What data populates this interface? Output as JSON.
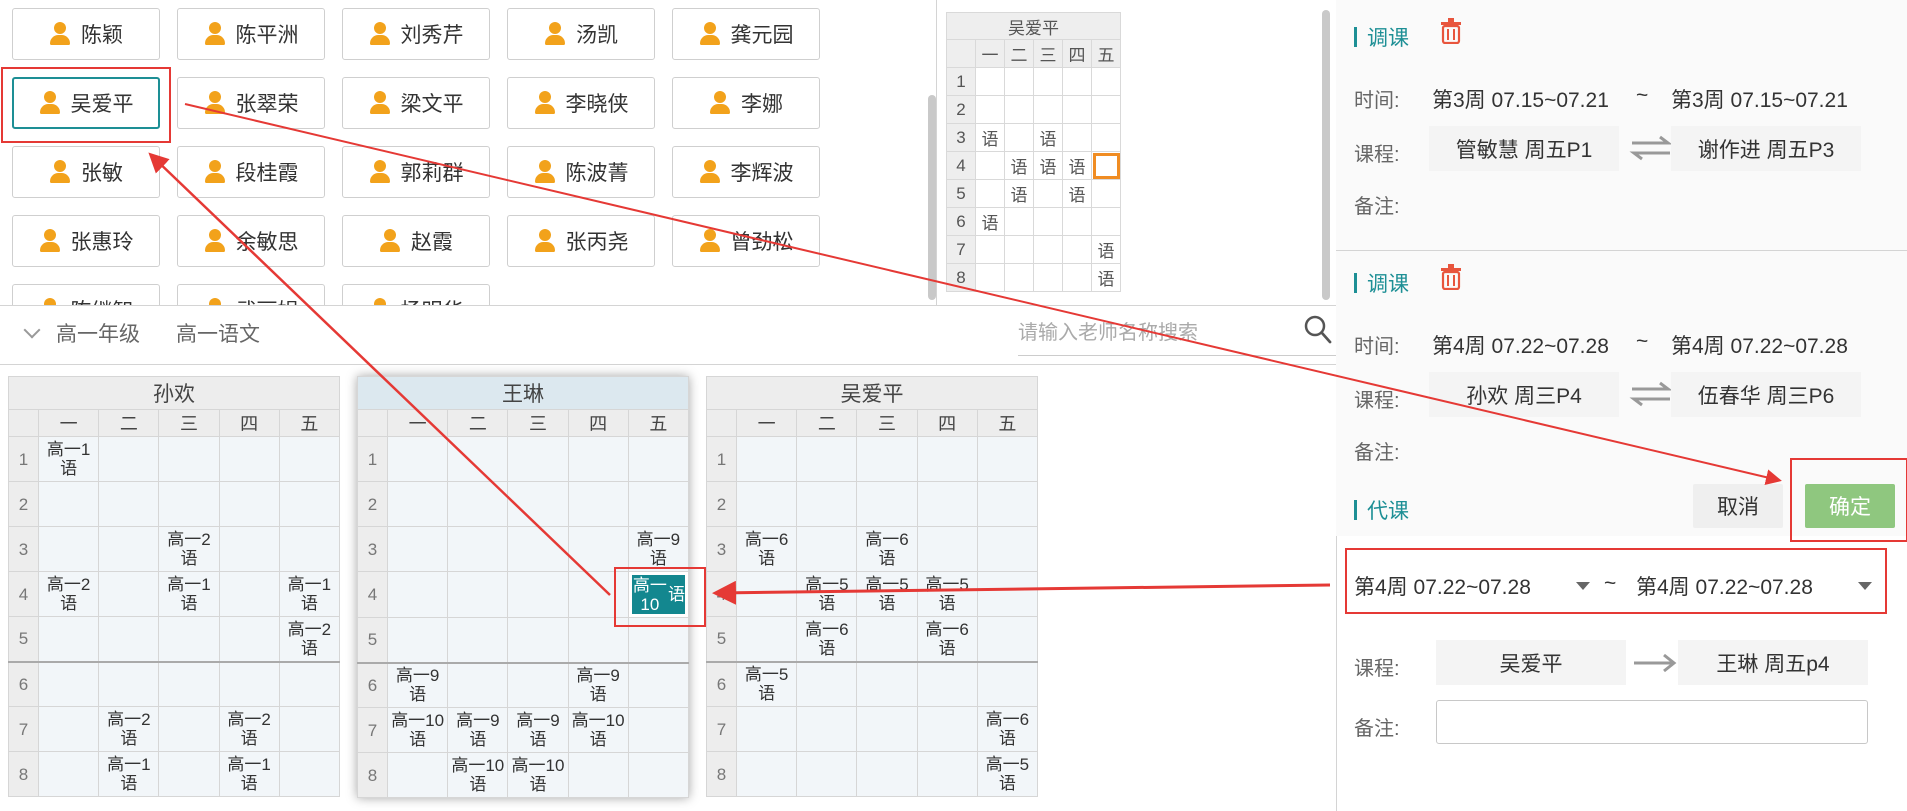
{
  "teacher_chips": [
    "陈颖",
    "陈平洲",
    "刘秀芹",
    "汤凯",
    "龚元园",
    "吴爱平",
    "张翠荣",
    "梁文平",
    "李晓侠",
    "李娜",
    "张敏",
    "段桂霞",
    "郭莉群",
    "陈波菁",
    "李辉波",
    "张惠玲",
    "余敏思",
    "赵霞",
    "张丙尧",
    "曾劲松",
    "陈继智",
    "武丽娟",
    "杨明华"
  ],
  "selected_teacher": "吴爱平",
  "mini_grid": {
    "title": "吴爱平",
    "days": [
      "一",
      "二",
      "三",
      "四",
      "五"
    ],
    "periods": [
      "1",
      "2",
      "3",
      "4",
      "5",
      "6",
      "7",
      "8"
    ],
    "cells": [
      [
        "",
        "",
        "",
        "",
        ""
      ],
      [
        "",
        "",
        "",
        "",
        ""
      ],
      [
        "语",
        "",
        "语",
        "",
        ""
      ],
      [
        "",
        "语",
        "语",
        "语",
        ""
      ],
      [
        "",
        "语",
        "",
        "语",
        ""
      ],
      [
        "语",
        "",
        "",
        "",
        ""
      ],
      [
        "",
        "",
        "",
        "",
        "语"
      ],
      [
        "",
        "",
        "",
        "",
        "语"
      ]
    ]
  },
  "filter": {
    "grade": "高一年级",
    "subject": "高一语文"
  },
  "search": {
    "placeholder": "请输入老师名称搜索"
  },
  "timetables": [
    {
      "name": "孙欢",
      "days": [
        "一",
        "二",
        "三",
        "四",
        "五"
      ],
      "periods": [
        "1",
        "2",
        "3",
        "4",
        "5",
        "6",
        "7",
        "8"
      ],
      "cells": [
        [
          "高一1语",
          "",
          "",
          "",
          ""
        ],
        [
          "",
          "",
          "",
          "",
          ""
        ],
        [
          "",
          "",
          "高一2语",
          "",
          ""
        ],
        [
          "高一2语",
          "",
          "高一1语",
          "",
          "高一1语"
        ],
        [
          "",
          "",
          "",
          "",
          "高一2语"
        ],
        [
          "",
          "",
          "",
          "",
          ""
        ],
        [
          "",
          "高一2语",
          "",
          "高一2语",
          ""
        ],
        [
          "",
          "高一1语",
          "",
          "高一1语",
          ""
        ]
      ]
    },
    {
      "name": "王琳",
      "days": [
        "一",
        "二",
        "三",
        "四",
        "五"
      ],
      "periods": [
        "1",
        "2",
        "3",
        "4",
        "5",
        "6",
        "7",
        "8"
      ],
      "cells": [
        [
          "",
          "",
          "",
          "",
          ""
        ],
        [
          "",
          "",
          "",
          "",
          ""
        ],
        [
          "",
          "",
          "",
          "",
          "高一9语"
        ],
        [
          "",
          "",
          "",
          "",
          "高一10语"
        ],
        [
          "",
          "",
          "",
          "",
          ""
        ],
        [
          "高一9语",
          "",
          "",
          "高一9语",
          ""
        ],
        [
          "高一10语",
          "高一9语",
          "高一9语",
          "高一10语",
          ""
        ],
        [
          "",
          "高一10语",
          "高一10语",
          "",
          ""
        ]
      ]
    },
    {
      "name": "吴爱平",
      "days": [
        "一",
        "二",
        "三",
        "四",
        "五"
      ],
      "periods": [
        "1",
        "2",
        "3",
        "4",
        "5",
        "6",
        "7",
        "8"
      ],
      "cells": [
        [
          "",
          "",
          "",
          "",
          ""
        ],
        [
          "",
          "",
          "",
          "",
          ""
        ],
        [
          "高一6语",
          "",
          "高一6语",
          "",
          ""
        ],
        [
          "",
          "高一5语",
          "高一5语",
          "高一5语",
          ""
        ],
        [
          "",
          "高一6语",
          "",
          "高一6语",
          ""
        ],
        [
          "高一5语",
          "",
          "",
          "",
          ""
        ],
        [
          "",
          "",
          "",
          "",
          "高一6语"
        ],
        [
          "",
          "",
          "",
          "",
          "高一5语"
        ]
      ]
    }
  ],
  "panel": {
    "swap1": {
      "title": "调课",
      "time_label": "时间:",
      "from": "第3周 07.15~07.21",
      "tilde": "~",
      "to": "第3周 07.15~07.21",
      "course_label": "课程:",
      "a": "管敏慧 周五P1",
      "b": "谢作进 周五P3",
      "note_label": "备注:"
    },
    "swap2": {
      "title": "调课",
      "time_label": "时间:",
      "from": "第4周 07.22~07.28",
      "tilde": "~",
      "to": "第4周 07.22~07.28",
      "course_label": "课程:",
      "a": "孙欢 周三P4",
      "b": "伍春华 周三P6",
      "note_label": "备注:"
    },
    "sub": {
      "title": "代课",
      "cancel": "取消",
      "confirm": "确定",
      "from": "第4周 07.22~07.28",
      "tilde": "~",
      "to": "第4周 07.22~07.28",
      "course_label": "课程:",
      "a": "吴爱平",
      "b": "王琳 周五p4",
      "note_label": "备注:",
      "note_value": ""
    }
  },
  "colors": {
    "accent": "#1d8f95",
    "confirm": "#8fc77f",
    "annotation": "#e53935",
    "highlight": "#f08c22"
  }
}
